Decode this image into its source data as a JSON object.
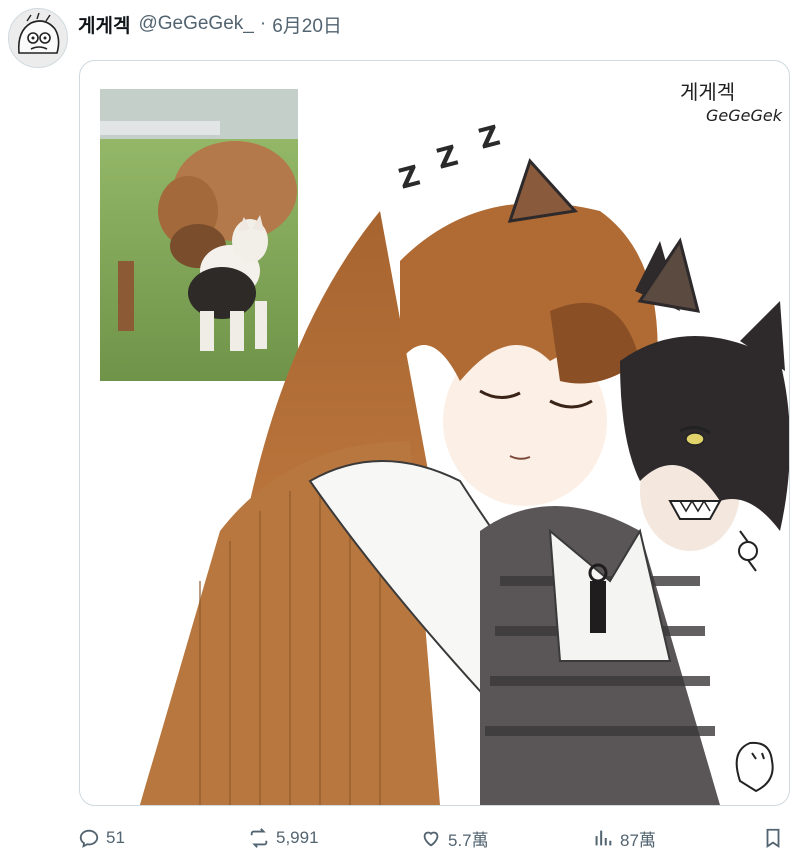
{
  "tweet": {
    "author": {
      "display_name": "게게겍",
      "handle": "@GeGeGek_",
      "separator": "·",
      "date": "6月20日"
    },
    "media": {
      "signature": [
        "게게겍",
        "GeGeGek"
      ],
      "sleep_text": [
        "Z",
        "Z",
        "Z"
      ]
    },
    "actions": {
      "reply_count": "51",
      "retweet_count": "5,991",
      "like_count": "5.7萬",
      "views_count": "87萬"
    }
  },
  "colors": {
    "text_primary": "#0f1419",
    "text_secondary": "#536471",
    "border": "#cfd9de",
    "hair_brown": "#b8703a",
    "hair_dark": "#2e2a2b"
  }
}
